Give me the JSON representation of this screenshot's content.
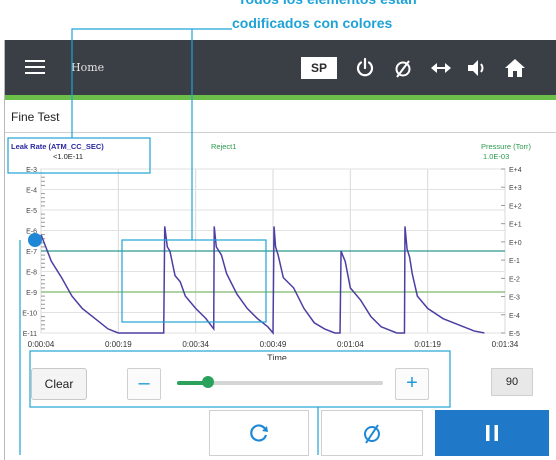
{
  "callout": {
    "line1": "Todos los elementos están",
    "line2": "codificados con colores"
  },
  "header": {
    "menu_icon": "hamburger-icon",
    "home_label": "Home",
    "sp_label": "SP",
    "icons": [
      "power-icon",
      "null-icon",
      "horizontal-arrows-icon",
      "speaker-icon",
      "home-icon"
    ]
  },
  "title_bar": {
    "title": "Fine Test"
  },
  "chart_data": {
    "type": "line",
    "left_axis_title": "Leak Rate (ATM_CC_SEC)",
    "left_axis_value": "<1.0E-11",
    "center_label": "Reject1",
    "right_axis_title": "Pressure (Torr)",
    "right_axis_value": "1.0E-03",
    "left_ticks": [
      "E-3",
      "E-4",
      "E-5",
      "E-6",
      "E-7",
      "E-8",
      "E-9",
      "E-10",
      "E-11"
    ],
    "right_ticks": [
      "E+4",
      "E+3",
      "E+2",
      "E+1",
      "E+0",
      "E-1",
      "E-2",
      "E-3",
      "E-4",
      "E-5"
    ],
    "x_ticks": [
      "0:00:04",
      "0:00:19",
      "0:00:34",
      "0:00:49",
      "0:01:04",
      "0:01:19",
      "0:01:34"
    ],
    "xlabel": "Time",
    "grid": true,
    "reject_line_exponent": -7,
    "lower_line_exponent": -9,
    "series": [
      {
        "color": "#4b3fa3",
        "x": [
          4,
          6,
          8,
          10,
          12,
          15,
          17,
          19,
          22,
          25,
          27.8,
          28,
          28.5,
          29,
          30,
          31,
          32,
          34,
          36,
          37.5,
          37.6,
          38,
          39,
          40,
          42,
          44,
          46,
          48,
          49,
          49.2,
          49.5,
          50,
          51,
          53,
          55,
          57,
          59,
          61,
          62,
          62.2,
          62.5,
          63,
          64,
          66,
          68,
          70,
          73,
          74.5,
          74.6,
          75,
          75.5,
          76,
          77,
          79,
          82,
          85,
          88,
          90
        ],
        "y": [
          -6.2,
          -7.5,
          -8.3,
          -9.2,
          -9.8,
          -10.4,
          -10.8,
          -11,
          -11,
          -11,
          -11,
          -5.8,
          -6.8,
          -7,
          -8.2,
          -8.5,
          -9.2,
          -9.8,
          -10.3,
          -10.8,
          -5.8,
          -6.8,
          -7.2,
          -8.1,
          -9.1,
          -9.8,
          -10.3,
          -10.7,
          -11,
          -5.8,
          -6.8,
          -7.2,
          -8.3,
          -8.8,
          -9.8,
          -10.5,
          -10.8,
          -11,
          -11,
          -7,
          -7.2,
          -7.5,
          -8.8,
          -9.4,
          -10.2,
          -10.7,
          -11,
          -11,
          -5.8,
          -6.9,
          -7.3,
          -8.1,
          -9.2,
          -9.8,
          -10.3,
          -10.6,
          -10.9,
          -11
        ]
      }
    ]
  },
  "controls": {
    "clear_label": "Clear",
    "minus_label": "–",
    "plus_label": "+",
    "slider_fraction": 0.15,
    "value_box": "90"
  },
  "bottom_buttons": [
    "refresh-icon",
    "null-icon",
    "pause-icon"
  ],
  "colors": {
    "header_bg": "#3a3e45",
    "accent_green": "#6cc04a",
    "callout_blue": "#1fa3d6",
    "series_purple": "#4b3fa3",
    "reject_line": "#2a9a8e",
    "pause_blue": "#1f78c8"
  }
}
